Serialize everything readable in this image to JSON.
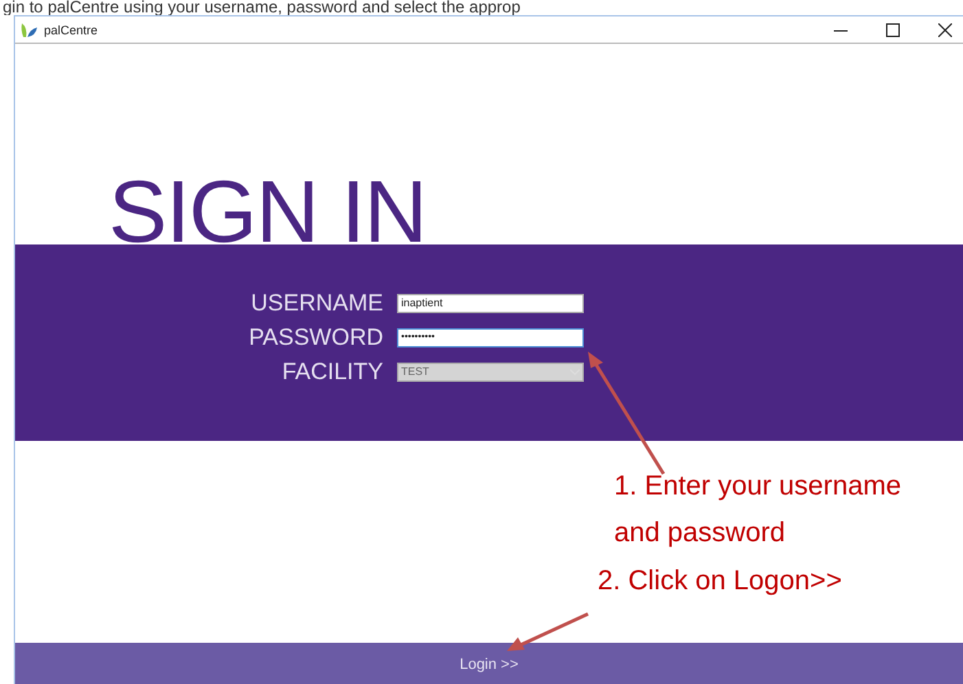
{
  "caption": "gin to palCentre using your username, password and select the approp",
  "window": {
    "title": "palCentre"
  },
  "heading": "SIGN IN",
  "fields": [
    {
      "kind": "text",
      "label": "USERNAME",
      "value": "inaptient",
      "focused": false,
      "disabled": false
    },
    {
      "kind": "password",
      "label": "PASSWORD",
      "value": "••••••••••",
      "focused": true,
      "disabled": false
    },
    {
      "kind": "select",
      "label": "FACILITY",
      "value": "TEST",
      "focused": false,
      "disabled": true
    }
  ],
  "annotations": [
    "1. Enter your username",
    "and password",
    "2. Click on Logon>>"
  ],
  "login_button": "Login >>"
}
